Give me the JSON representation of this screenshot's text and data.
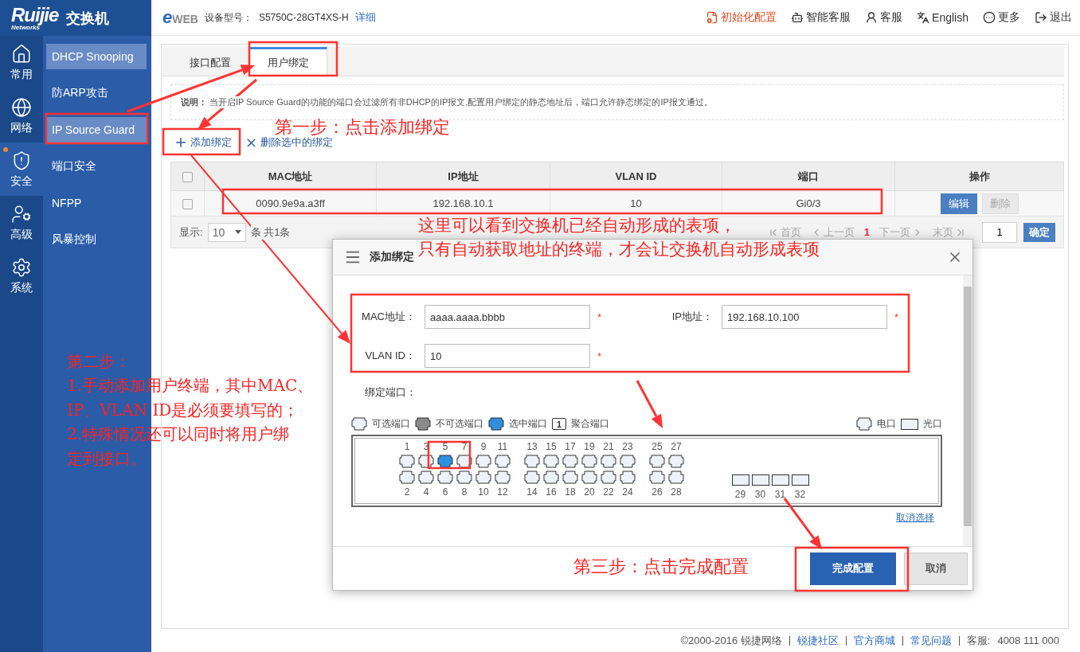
{
  "header": {
    "logo": "Ruijie",
    "logo_sub": "Networks",
    "product": "交换机",
    "eweb": "eWEB",
    "model_label": "设备型号：",
    "model": "S5750C-28GT4XS-H",
    "detail_link": "详细",
    "actions": [
      {
        "kind": "init",
        "label": "初始化配置"
      },
      {
        "kind": "bot",
        "label": "智能客服"
      },
      {
        "kind": "service",
        "label": "客服"
      },
      {
        "kind": "language",
        "label": "English"
      },
      {
        "kind": "more",
        "label": "更多"
      },
      {
        "kind": "logout",
        "label": "退出"
      }
    ]
  },
  "nav_rail": [
    {
      "kind": "home",
      "label": "常用",
      "selected": false,
      "badge": false
    },
    {
      "kind": "network",
      "label": "网络",
      "selected": false,
      "badge": false
    },
    {
      "kind": "security",
      "label": "安全",
      "selected": true,
      "badge": true
    },
    {
      "kind": "advanced",
      "label": "高级",
      "selected": false,
      "badge": false
    },
    {
      "kind": "system",
      "label": "系统",
      "selected": false,
      "badge": false
    }
  ],
  "submenu": [
    {
      "label": "DHCP Snooping",
      "selected": true
    },
    {
      "label": "防ARP攻击",
      "selected": false
    },
    {
      "label": "IP Source Guard",
      "selected": true
    },
    {
      "label": "端口安全",
      "selected": false
    },
    {
      "label": "NFPP",
      "selected": false
    },
    {
      "label": "风暴控制",
      "selected": false
    }
  ],
  "tabs": [
    {
      "label": "接口配置",
      "selected": false
    },
    {
      "label": "用户绑定",
      "selected": true
    }
  ],
  "notice": "**说明：** 当开启IP Source Guard的功能的端口会过滤所有非DHCP的IP报文,配置用户绑定的静态地址后，端口允许静态绑定的IP报文通过。",
  "toolbar": [
    {
      "kind": "add",
      "label": "添加绑定"
    },
    {
      "kind": "delete",
      "label": "删除选中的绑定"
    }
  ],
  "table": {
    "columns": [
      "MAC地址",
      "IP地址",
      "VLAN ID",
      "端口",
      "操作"
    ],
    "header_checked": false,
    "rows": [
      {
        "checked": false,
        "cells": [
          "0090.9e9a.a3ff",
          "192.168.10.1",
          "10",
          "Gi0/3"
        ],
        "actions": [
          {
            "label": "编辑",
            "disabled": false
          },
          {
            "label": "删除",
            "disabled": true
          }
        ]
      }
    ]
  },
  "pager": {
    "show_label": "显示:",
    "page_size": "10",
    "total": "条 共1条",
    "page_input": "1",
    "go": "确定",
    "links": [
      {
        "kind": "first",
        "label": "首页"
      },
      {
        "kind": "prev",
        "label": "上一页"
      },
      {
        "kind": "current",
        "label": "1"
      },
      {
        "kind": "next",
        "label": "下一页"
      },
      {
        "kind": "last",
        "label": "末页"
      }
    ]
  },
  "dialog": {
    "title": "添加绑定",
    "port_label": "绑定端口：",
    "clear_link": "取消选择",
    "fields": [
      {
        "label": "MAC地址：",
        "value": "aaaa.aaaa.bbbb",
        "required": "*"
      },
      {
        "label": "IP地址：",
        "value": "192.168.10.100",
        "required": "*"
      },
      {
        "label": "VLAN ID：",
        "value": "10",
        "required": "*"
      }
    ],
    "legend": [
      {
        "kind": "available",
        "label": "可选端口"
      },
      {
        "kind": "unavailable",
        "label": "不可选端口"
      },
      {
        "kind": "selected",
        "label": "选中端口"
      },
      {
        "kind": "aggregate",
        "mark": "1",
        "label": "聚合端口"
      }
    ],
    "legend_right": [
      {
        "kind": "copper",
        "label": "电口"
      },
      {
        "kind": "fiber",
        "label": "光口"
      }
    ],
    "port_groups": [
      {
        "kind": "copper",
        "columns": [
          {
            "top": {
              "label": "1",
              "selected": false
            },
            "bottom": {
              "label": "2",
              "selected": false
            }
          },
          {
            "top": {
              "label": "3",
              "selected": false
            },
            "bottom": {
              "label": "4",
              "selected": false
            }
          },
          {
            "top": {
              "label": "5",
              "selected": true
            },
            "bottom": {
              "label": "6",
              "selected": false
            }
          },
          {
            "top": {
              "label": "7",
              "selected": false
            },
            "bottom": {
              "label": "8",
              "selected": false
            }
          },
          {
            "top": {
              "label": "9",
              "selected": false
            },
            "bottom": {
              "label": "10",
              "selected": false
            }
          },
          {
            "top": {
              "label": "11",
              "selected": false
            },
            "bottom": {
              "label": "12",
              "selected": false
            }
          }
        ]
      },
      {
        "kind": "copper",
        "columns": [
          {
            "top": {
              "label": "13",
              "selected": false
            },
            "bottom": {
              "label": "14",
              "selected": false
            }
          },
          {
            "top": {
              "label": "15",
              "selected": false
            },
            "bottom": {
              "label": "16",
              "selected": false
            }
          },
          {
            "top": {
              "label": "17",
              "selected": false
            },
            "bottom": {
              "label": "18",
              "selected": false
            }
          },
          {
            "top": {
              "label": "19",
              "selected": false
            },
            "bottom": {
              "label": "20",
              "selected": false
            }
          },
          {
            "top": {
              "label": "21",
              "selected": false
            },
            "bottom": {
              "label": "22",
              "selected": false
            }
          },
          {
            "top": {
              "label": "23",
              "selected": false
            },
            "bottom": {
              "label": "24",
              "selected": false
            }
          }
        ]
      },
      {
        "kind": "copper",
        "columns": [
          {
            "top": {
              "label": "25",
              "selected": false
            },
            "bottom": {
              "label": "26",
              "selected": false
            }
          },
          {
            "top": {
              "label": "27",
              "selected": false
            },
            "bottom": {
              "label": "28",
              "selected": false
            }
          }
        ]
      },
      {
        "kind": "fiber",
        "ports": [
          {
            "label": "29",
            "selected": false
          },
          {
            "label": "30",
            "selected": false
          },
          {
            "label": "31",
            "selected": false
          },
          {
            "label": "32",
            "selected": false
          }
        ]
      }
    ],
    "buttons": [
      {
        "kind": "primary",
        "label": "完成配置"
      },
      {
        "kind": "secondary",
        "label": "取消"
      }
    ]
  },
  "annotations": [
    "第一步：点击添加绑定",
    "这里可以看到交换机已经自动形成的表项，",
    "只有自动获取地址的终端，才会让交换机自动形成表项",
    "第二步：",
    "1.手动添加用户终端，其中MAC、",
    "IP、VLAN ID是必须要填写的；",
    "2.特殊情况还可以同时将用户绑",
    "定到接口。",
    "第三步：点击完成配置"
  ],
  "footer": {
    "copyright": "©2000-2016 锐捷网络",
    "links": [
      "锐捷社区",
      "官方商城",
      "常见问题"
    ],
    "service_label": "客服:",
    "phone": "4008 111 000"
  }
}
